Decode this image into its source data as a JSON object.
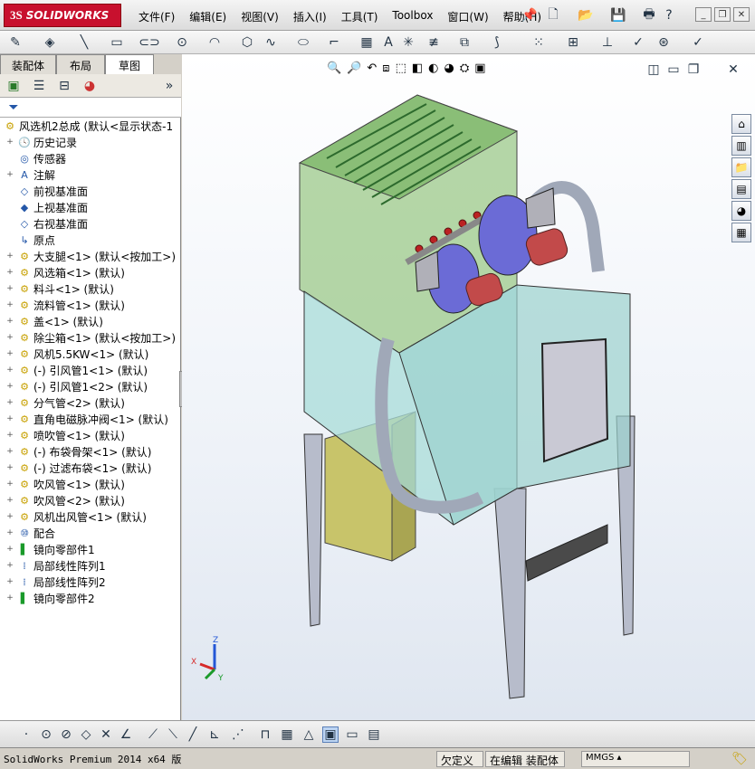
{
  "app": {
    "logo_ds": "3S",
    "logo_text": "SOLIDWORKS"
  },
  "menu": [
    "文件(F)",
    "编辑(E)",
    "视图(V)",
    "插入(I)",
    "工具(T)",
    "Toolbox",
    "窗口(W)",
    "帮助(H)"
  ],
  "tabs": [
    "装配体",
    "布局",
    "草图"
  ],
  "tree": {
    "root": "风选机2总成  (默认<显示状态-1",
    "items": [
      {
        "exp": "+",
        "icon": "history-icon",
        "glyph": "🕓",
        "label": "历史记录"
      },
      {
        "exp": "",
        "icon": "sensor-icon",
        "glyph": "◎",
        "label": "传感器"
      },
      {
        "exp": "+",
        "icon": "annotation-icon",
        "glyph": "A",
        "label": "注解"
      },
      {
        "exp": "",
        "icon": "plane-icon",
        "glyph": "◇",
        "label": "前视基准面"
      },
      {
        "exp": "",
        "icon": "plane-icon",
        "glyph": "◆",
        "label": "上视基准面"
      },
      {
        "exp": "",
        "icon": "plane-icon",
        "glyph": "◇",
        "label": "右视基准面"
      },
      {
        "exp": "",
        "icon": "origin-icon",
        "glyph": "↳",
        "label": "原点"
      },
      {
        "exp": "+",
        "icon": "component-icon",
        "glyph": "⚙",
        "label": "大支腿<1> (默认<按加工>)"
      },
      {
        "exp": "+",
        "icon": "component-icon",
        "glyph": "⚙",
        "label": "风选箱<1> (默认)"
      },
      {
        "exp": "+",
        "icon": "component-icon",
        "glyph": "⚙",
        "label": "料斗<1> (默认)"
      },
      {
        "exp": "+",
        "icon": "component-icon",
        "glyph": "⚙",
        "label": "流料管<1> (默认)"
      },
      {
        "exp": "+",
        "icon": "component-icon",
        "glyph": "⚙",
        "label": "盖<1> (默认)"
      },
      {
        "exp": "+",
        "icon": "component-icon",
        "glyph": "⚙",
        "label": "除尘箱<1> (默认<按加工>)"
      },
      {
        "exp": "+",
        "icon": "component-icon",
        "glyph": "⚙",
        "label": "风机5.5KW<1> (默认)"
      },
      {
        "exp": "+",
        "icon": "component-icon",
        "glyph": "⚙",
        "label": "(-) 引风管1<1> (默认)"
      },
      {
        "exp": "+",
        "icon": "component-icon",
        "glyph": "⚙",
        "label": "(-) 引风管1<2> (默认)"
      },
      {
        "exp": "+",
        "icon": "component-icon",
        "glyph": "⚙",
        "label": "分气管<2> (默认)"
      },
      {
        "exp": "+",
        "icon": "component-icon",
        "glyph": "⚙",
        "label": "直角电磁脉冲阀<1> (默认)"
      },
      {
        "exp": "+",
        "icon": "component-icon",
        "glyph": "⚙",
        "label": "喷吹管<1> (默认)"
      },
      {
        "exp": "+",
        "icon": "component-icon",
        "glyph": "⚙",
        "label": "(-) 布袋骨架<1> (默认)"
      },
      {
        "exp": "+",
        "icon": "component-icon",
        "glyph": "⚙",
        "label": "(-) 过滤布袋<1> (默认)"
      },
      {
        "exp": "+",
        "icon": "component-icon",
        "glyph": "⚙",
        "label": "吹风管<1> (默认)"
      },
      {
        "exp": "+",
        "icon": "component-icon",
        "glyph": "⚙",
        "label": "吹风管<2> (默认)"
      },
      {
        "exp": "+",
        "icon": "component-icon",
        "glyph": "⚙",
        "label": "风机出风管<1> (默认)"
      },
      {
        "exp": "+",
        "icon": "mate-icon",
        "glyph": "⑩",
        "label": "配合"
      },
      {
        "exp": "+",
        "icon": "mirror-icon",
        "glyph": "▌",
        "label": "镜向零部件1"
      },
      {
        "exp": "+",
        "icon": "pattern-icon",
        "glyph": "⁞",
        "label": "局部线性阵列1"
      },
      {
        "exp": "+",
        "icon": "pattern-icon",
        "glyph": "⁞",
        "label": "局部线性阵列2"
      },
      {
        "exp": "+",
        "icon": "mirror-icon",
        "glyph": "▌",
        "label": "镜向零部件2"
      }
    ]
  },
  "triad": {
    "x": "X",
    "y": "Y",
    "z": "Z"
  },
  "status": {
    "version": "SolidWorks Premium 2014 x64 版",
    "state": "欠定义",
    "mode": "在编辑 装配体",
    "units": "MMGS"
  },
  "colors": {
    "logo_red": "#c8102e",
    "top_box": "#9cc98a",
    "mid_box": "#a8dcd8",
    "hopper": "#c8c46a",
    "fan": "#6b6bd6",
    "motor": "#c24a4a",
    "leg": "#b7bccb"
  }
}
